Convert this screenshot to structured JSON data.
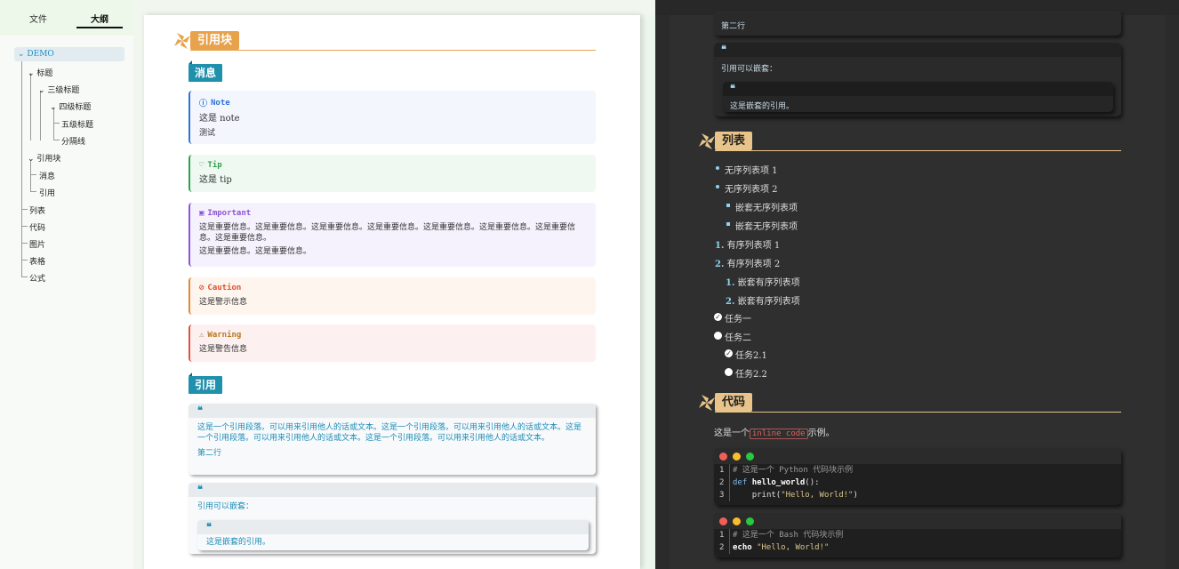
{
  "sidebar": {
    "tabs": {
      "file": "文件",
      "outline": "大纲"
    },
    "outline": [
      {
        "label": "DEMO"
      },
      {
        "label": "标题"
      },
      {
        "label": "三级标题"
      },
      {
        "label": "四级标题"
      },
      {
        "label": "五级标题"
      },
      {
        "label": "分隔线"
      },
      {
        "label": "引用块"
      },
      {
        "label": "消息"
      },
      {
        "label": "引用"
      },
      {
        "label": "列表"
      },
      {
        "label": "代码"
      },
      {
        "label": "图片"
      },
      {
        "label": "表格"
      },
      {
        "label": "公式"
      }
    ]
  },
  "left": {
    "h2": "引用块",
    "h3_message": "消息",
    "alerts": [
      {
        "title": "Note",
        "lines": [
          "这是 note",
          "测试"
        ],
        "color": "#2f73d8"
      },
      {
        "title": "Tip",
        "lines": [
          "这是 tip"
        ],
        "color": "#2ea14a"
      },
      {
        "title": "Important",
        "lines": [
          "这是重要信息。这是重要信息。这是重要信息。这是重要信息。这是重要信息。这是重要信息。这是重要信息。这是重要信息。",
          "这是重要信息。这是重要信息。"
        ],
        "color": "#8a55d6"
      },
      {
        "title": "Caution",
        "lines": [
          "这是警示信息"
        ],
        "color": "#e0512f"
      },
      {
        "title": "Warning",
        "lines": [
          "这是警告信息"
        ],
        "color": "#b7791f"
      }
    ],
    "h3_quote": "引用",
    "quote1": {
      "mark": "❝",
      "text": "这是一个引用段落。可以用来引用他人的话或文本。这是一个引用段落。可以用来引用他人的话或文本。这是一个引用段落。可以用来引用他人的话或文本。这是一个引用段落。可以用来引用他人的话或文本。",
      "line2": "第二行"
    },
    "quote2": {
      "mark": "❝",
      "text": "引用可以嵌套：",
      "nested_mark": "❝",
      "nested": "这是嵌套的引用。"
    }
  },
  "right": {
    "quote_tail": "第二行",
    "quote2": {
      "mark": "❝",
      "text": "引用可以嵌套：",
      "nested_mark": "❝",
      "nested": "这是嵌套的引用。"
    },
    "h2_list": "列表",
    "list": {
      "ul1": "无序列表项 1",
      "ul2": "无序列表项 2",
      "ul2a": "嵌套无序列表项",
      "ul2b": "嵌套无序列表项",
      "ol1_num": "1.",
      "ol1": "有序列表项 1",
      "ol2_num": "2.",
      "ol2": "有序列表项 2",
      "ol2a_num": "1.",
      "ol2a": "嵌套有序列表项",
      "ol2b_num": "2.",
      "ol2b": "嵌套有序列表项",
      "task1": "任务一",
      "task2": "任务二",
      "task21": "任务2.1",
      "task22": "任务2.2"
    },
    "h2_code": "代码",
    "code_intro_pre": "这是一个",
    "inline_code": "inline code",
    "code_intro_post": "示例。",
    "code1": {
      "nums": [
        "1",
        "2",
        "3"
      ],
      "comment": "# 这是一个 Python 代码块示例",
      "def": "def ",
      "fn": "hello_world",
      "paren": "():",
      "indent": "    ",
      "call": "print(",
      "str": "\"Hello, World!\"",
      "close": ")"
    },
    "code2": {
      "nums": [
        "1",
        "2"
      ],
      "comment": "# 这是一个 Bash 代码块示例",
      "echo": "echo ",
      "str": "\"Hello, World!\""
    }
  },
  "colors": {
    "accent_orange": "#e8a24c",
    "heading_blue": "#1f91ad",
    "quote_blue": "#1b8eb8"
  }
}
